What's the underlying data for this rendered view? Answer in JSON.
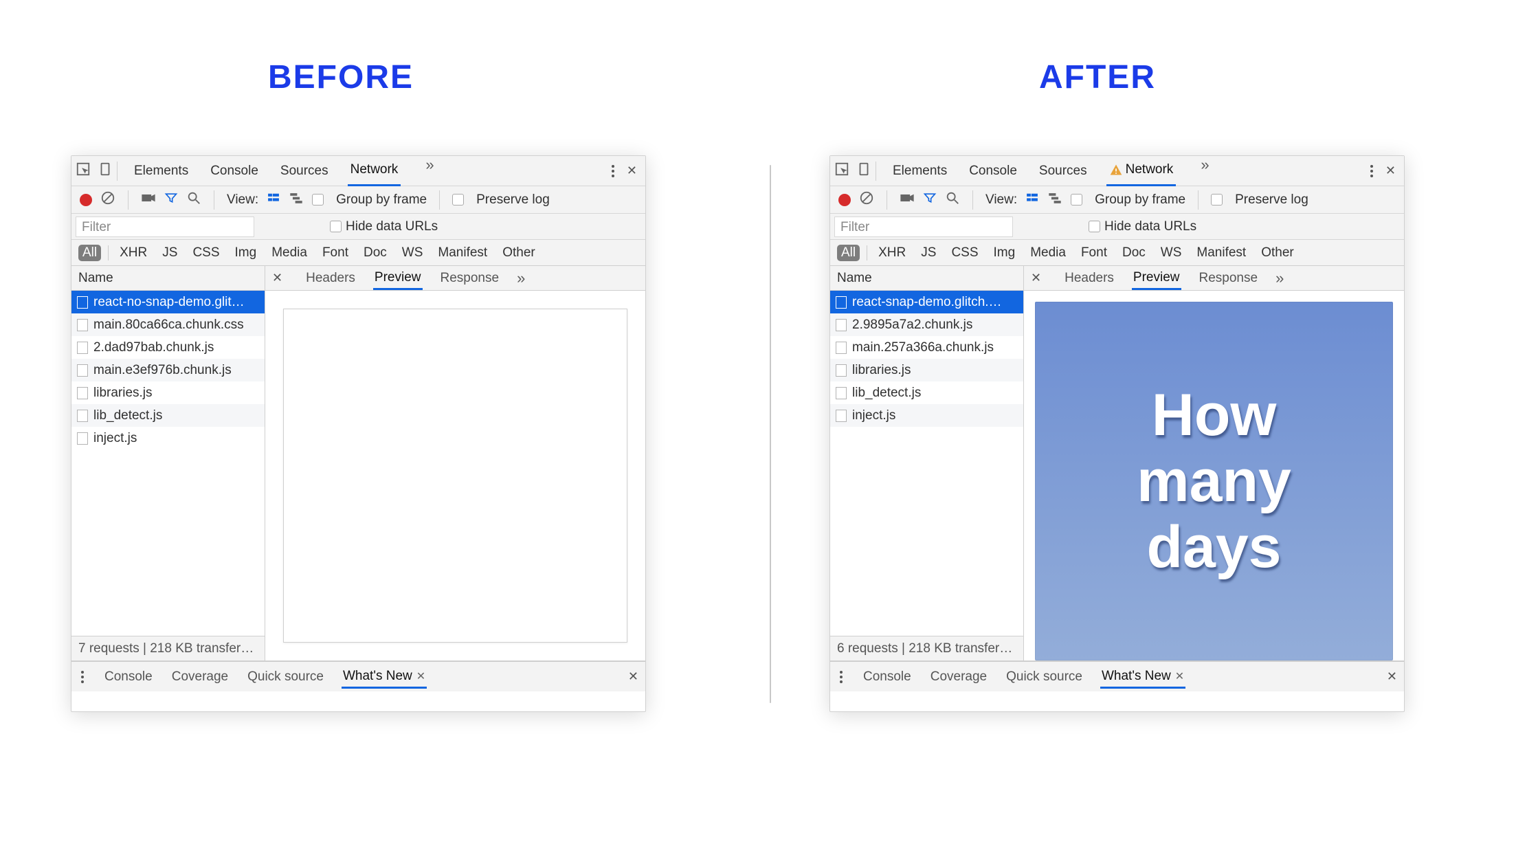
{
  "headings": {
    "before": "BEFORE",
    "after": "AFTER"
  },
  "panels": {
    "before": {
      "main_tabs": [
        "Elements",
        "Console",
        "Sources",
        "Network"
      ],
      "active_tab": "Network",
      "has_warning": false,
      "toolbar": {
        "view_label": "View:",
        "group_by_frame": "Group by frame",
        "preserve_log": "Preserve log"
      },
      "filter_placeholder": "Filter",
      "hide_data_urls": "Hide data URLs",
      "resource_types": [
        "All",
        "XHR",
        "JS",
        "CSS",
        "Img",
        "Media",
        "Font",
        "Doc",
        "WS",
        "Manifest",
        "Other"
      ],
      "name_header": "Name",
      "requests": [
        "react-no-snap-demo.glit…",
        "main.80ca66ca.chunk.css",
        "2.dad97bab.chunk.js",
        "main.e3ef976b.chunk.js",
        "libraries.js",
        "lib_detect.js",
        "inject.js"
      ],
      "selected_index": 0,
      "status_text": "7 requests | 218 KB transfer…",
      "detail_tabs": [
        "Headers",
        "Preview",
        "Response"
      ],
      "detail_active": "Preview",
      "preview": {
        "kind": "blank"
      },
      "drawer_tabs": [
        "Console",
        "Coverage",
        "Quick source",
        "What's New"
      ],
      "drawer_active": "What's New"
    },
    "after": {
      "main_tabs": [
        "Elements",
        "Console",
        "Sources",
        "Network"
      ],
      "active_tab": "Network",
      "has_warning": true,
      "toolbar": {
        "view_label": "View:",
        "group_by_frame": "Group by frame",
        "preserve_log": "Preserve log"
      },
      "filter_placeholder": "Filter",
      "hide_data_urls": "Hide data URLs",
      "resource_types": [
        "All",
        "XHR",
        "JS",
        "CSS",
        "Img",
        "Media",
        "Font",
        "Doc",
        "WS",
        "Manifest",
        "Other"
      ],
      "name_header": "Name",
      "requests": [
        "react-snap-demo.glitch.…",
        "2.9895a7a2.chunk.js",
        "main.257a366a.chunk.js",
        "libraries.js",
        "lib_detect.js",
        "inject.js"
      ],
      "selected_index": 0,
      "status_text": "6 requests | 218 KB transfer…",
      "detail_tabs": [
        "Headers",
        "Preview",
        "Response"
      ],
      "detail_active": "Preview",
      "preview": {
        "kind": "hero",
        "text": "How\nmany\ndays"
      },
      "drawer_tabs": [
        "Console",
        "Coverage",
        "Quick source",
        "What's New"
      ],
      "drawer_active": "What's New"
    }
  }
}
